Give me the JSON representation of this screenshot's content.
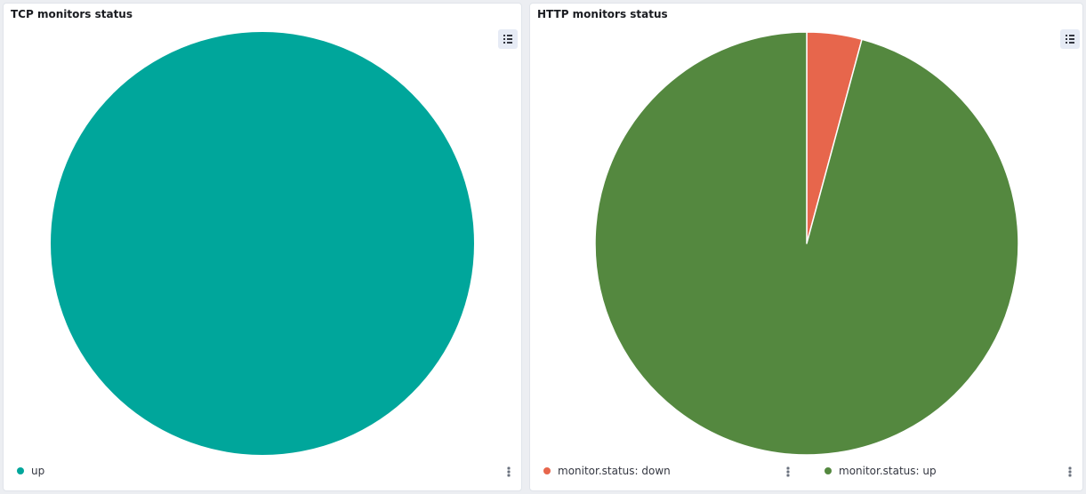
{
  "panels": [
    {
      "title": "TCP monitors status",
      "legend_toggle_icon": "list-icon",
      "legend_menu_icon": "vertical-dots-icon"
    },
    {
      "title": "HTTP monitors status",
      "legend_toggle_icon": "list-icon",
      "legend_menu_icon": "vertical-dots-icon"
    }
  ],
  "chart_data": [
    {
      "type": "pie",
      "title": "TCP monitors status",
      "legend_position": "bottom",
      "slices": [
        {
          "label": "up",
          "value": 1,
          "color": "#00a69b"
        }
      ]
    },
    {
      "type": "pie",
      "title": "HTTP monitors status",
      "legend_position": "bottom",
      "slices": [
        {
          "label": "monitor.status: down",
          "value": 0.042,
          "color": "#e7664c"
        },
        {
          "label": "monitor.status: up",
          "value": 0.958,
          "color": "#54883f"
        }
      ]
    }
  ]
}
